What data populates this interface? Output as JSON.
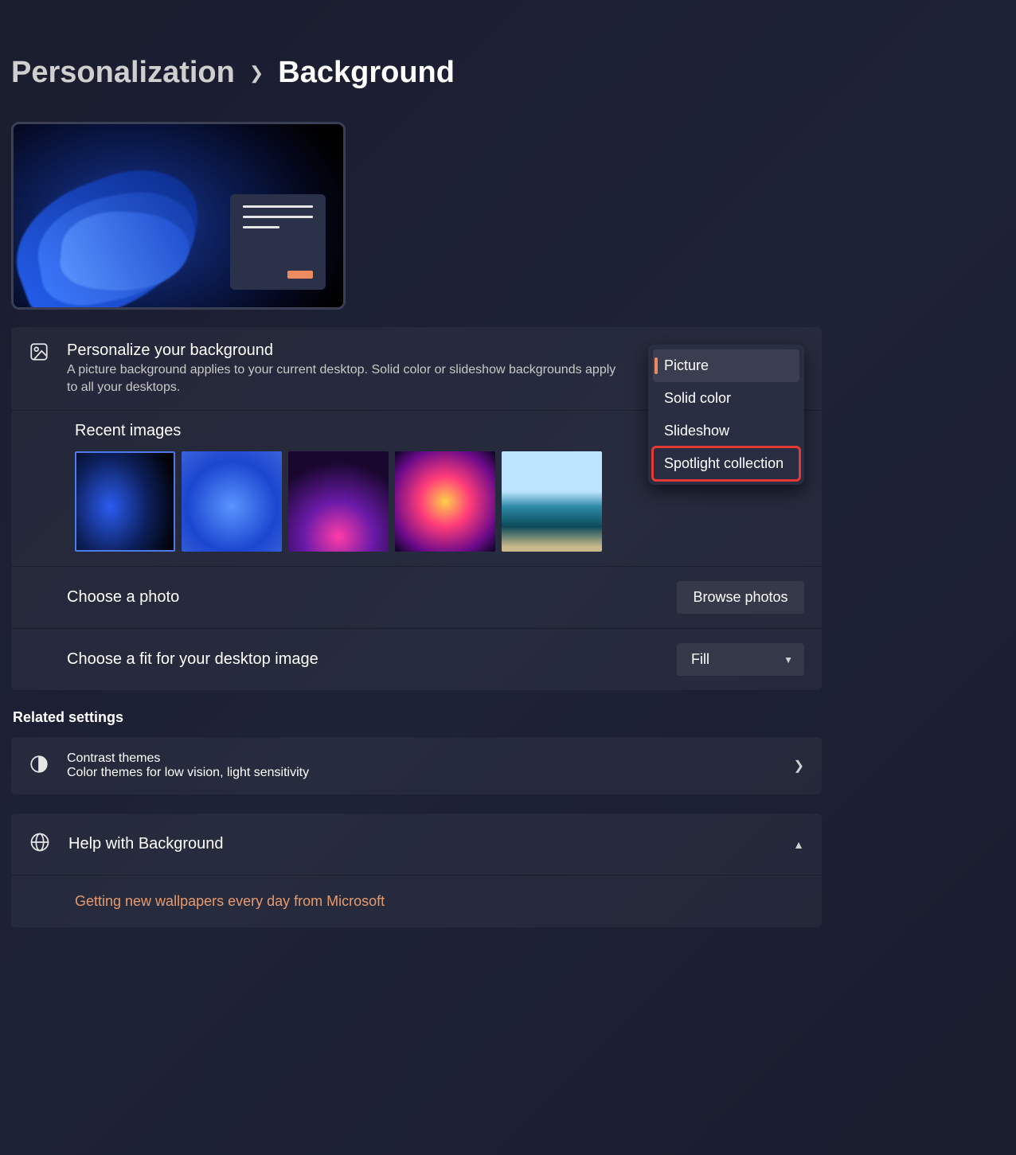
{
  "breadcrumb": {
    "parent": "Personalization",
    "current": "Background"
  },
  "personalize": {
    "title": "Personalize your background",
    "description": "A picture background applies to your current desktop. Solid color or slideshow backgrounds apply to all your desktops."
  },
  "dropdown": {
    "options": [
      "Picture",
      "Solid color",
      "Slideshow",
      "Spotlight collection"
    ],
    "selected_index": 0,
    "highlighted_index": 3
  },
  "recent": {
    "heading": "Recent images"
  },
  "choose_photo": {
    "label": "Choose a photo",
    "button": "Browse photos"
  },
  "fit": {
    "label": "Choose a fit for your desktop image",
    "value": "Fill"
  },
  "related": {
    "heading": "Related settings",
    "contrast_title": "Contrast themes",
    "contrast_sub": "Color themes for low vision, light sensitivity"
  },
  "help": {
    "title": "Help with Background",
    "link": "Getting new wallpapers every day from Microsoft"
  }
}
